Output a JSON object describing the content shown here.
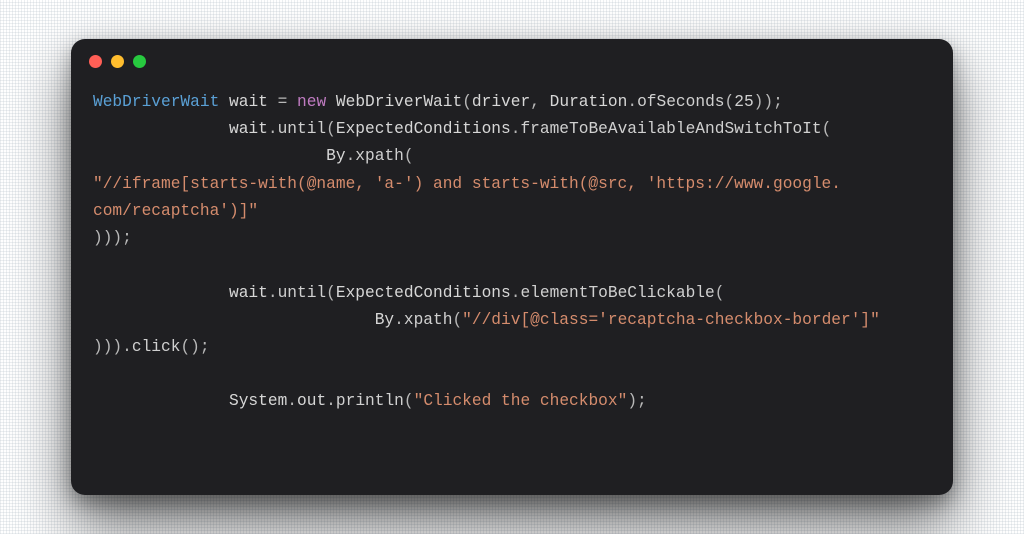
{
  "window": {
    "controls": {
      "red": "close",
      "yellow": "minimize",
      "green": "zoom"
    }
  },
  "colors": {
    "bg": "#1f1f22",
    "dot_red": "#ff5f56",
    "dot_yellow": "#ffbd2e",
    "dot_green": "#27c93f",
    "type": "#5aa0d6",
    "keyword": "#bf7bc1",
    "string": "#d58c6d",
    "text": "#d7d7d7"
  },
  "code": {
    "tokens": [
      [
        {
          "c": "type",
          "t": "WebDriverWait"
        },
        {
          "c": "plain",
          "t": " wait "
        },
        {
          "c": "punct",
          "t": "= "
        },
        {
          "c": "key",
          "t": "new"
        },
        {
          "c": "plain",
          "t": " WebDriverWait"
        },
        {
          "c": "punct",
          "t": "("
        },
        {
          "c": "plain",
          "t": "driver"
        },
        {
          "c": "punct",
          "t": ", "
        },
        {
          "c": "plain",
          "t": "Duration"
        },
        {
          "c": "punct",
          "t": "."
        },
        {
          "c": "call",
          "t": "ofSeconds"
        },
        {
          "c": "punct",
          "t": "("
        },
        {
          "c": "num",
          "t": "25"
        },
        {
          "c": "punct",
          "t": "));"
        }
      ],
      [
        {
          "c": "plain",
          "t": "              wait"
        },
        {
          "c": "punct",
          "t": "."
        },
        {
          "c": "call",
          "t": "until"
        },
        {
          "c": "punct",
          "t": "("
        },
        {
          "c": "plain",
          "t": "ExpectedConditions"
        },
        {
          "c": "punct",
          "t": "."
        },
        {
          "c": "call",
          "t": "frameToBeAvailableAndSwitchToIt"
        },
        {
          "c": "punct",
          "t": "("
        }
      ],
      [
        {
          "c": "plain",
          "t": "                        By"
        },
        {
          "c": "punct",
          "t": "."
        },
        {
          "c": "call",
          "t": "xpath"
        },
        {
          "c": "punct",
          "t": "("
        }
      ],
      [
        {
          "c": "str",
          "t": "\"//iframe[starts-with(@name, 'a-') and starts-with(@src, 'https://www.google."
        }
      ],
      [
        {
          "c": "str",
          "t": "com/recaptcha')]\""
        }
      ],
      [
        {
          "c": "punct",
          "t": ")));"
        }
      ],
      [
        {
          "c": "plain",
          "t": ""
        }
      ],
      [
        {
          "c": "plain",
          "t": "              wait"
        },
        {
          "c": "punct",
          "t": "."
        },
        {
          "c": "call",
          "t": "until"
        },
        {
          "c": "punct",
          "t": "("
        },
        {
          "c": "plain",
          "t": "ExpectedConditions"
        },
        {
          "c": "punct",
          "t": "."
        },
        {
          "c": "call",
          "t": "elementToBeClickable"
        },
        {
          "c": "punct",
          "t": "("
        }
      ],
      [
        {
          "c": "plain",
          "t": "                             By"
        },
        {
          "c": "punct",
          "t": "."
        },
        {
          "c": "call",
          "t": "xpath"
        },
        {
          "c": "punct",
          "t": "("
        },
        {
          "c": "str",
          "t": "\"//div[@class='recaptcha-checkbox-border']\""
        }
      ],
      [
        {
          "c": "punct",
          "t": ")))."
        },
        {
          "c": "call",
          "t": "click"
        },
        {
          "c": "punct",
          "t": "();"
        }
      ],
      [
        {
          "c": "plain",
          "t": ""
        }
      ],
      [
        {
          "c": "plain",
          "t": "              System"
        },
        {
          "c": "punct",
          "t": "."
        },
        {
          "c": "plain",
          "t": "out"
        },
        {
          "c": "punct",
          "t": "."
        },
        {
          "c": "call",
          "t": "println"
        },
        {
          "c": "punct",
          "t": "("
        },
        {
          "c": "str",
          "t": "\"Clicked the checkbox\""
        },
        {
          "c": "punct",
          "t": ");"
        }
      ]
    ]
  }
}
